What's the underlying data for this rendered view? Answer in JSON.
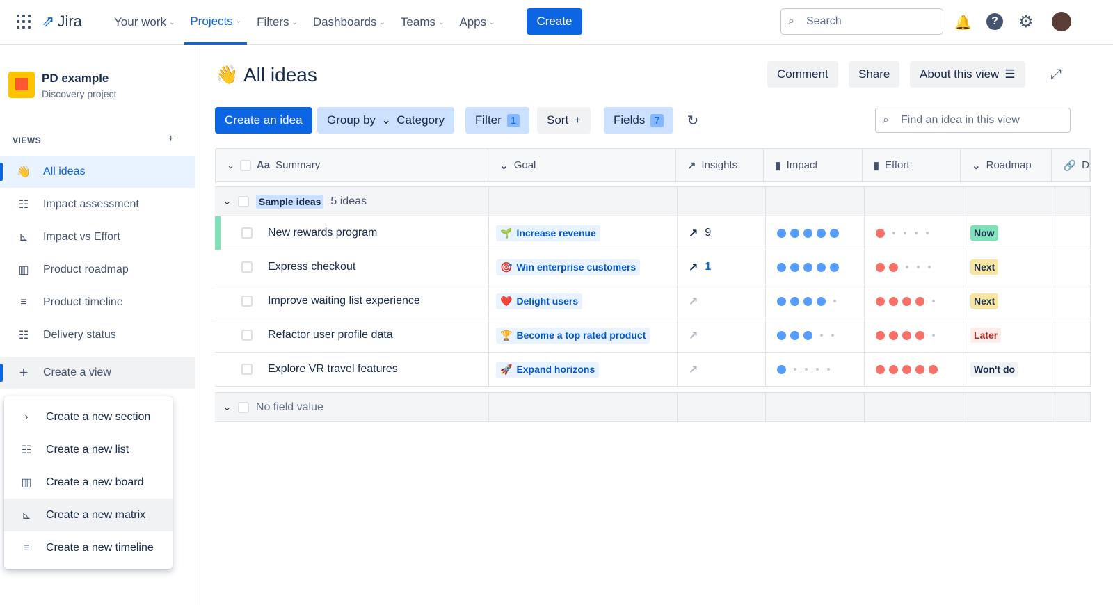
{
  "topnav": {
    "product": "Jira",
    "items": [
      "Your work",
      "Projects",
      "Filters",
      "Dashboards",
      "Teams",
      "Apps"
    ],
    "active": "Projects",
    "create": "Create",
    "search_placeholder": "Search"
  },
  "project": {
    "name": "PD example",
    "type": "Discovery project"
  },
  "sidebar": {
    "views_label": "VIEWS",
    "items": [
      {
        "label": "All ideas",
        "icon": "wave-emoji"
      },
      {
        "label": "Impact assessment",
        "icon": "list-icon"
      },
      {
        "label": "Impact vs Effort",
        "icon": "matrix-icon"
      },
      {
        "label": "Product roadmap",
        "icon": "board-icon"
      },
      {
        "label": "Product timeline",
        "icon": "timeline-icon"
      },
      {
        "label": "Delivery status",
        "icon": "list-icon"
      }
    ],
    "create_view": "Create a view"
  },
  "create_menu": {
    "items": [
      "Create a new section",
      "Create a new list",
      "Create a new board",
      "Create a new matrix",
      "Create a new timeline"
    ]
  },
  "header": {
    "title": "All ideas",
    "comment": "Comment",
    "share": "Share",
    "about": "About this view"
  },
  "toolbar": {
    "create_idea": "Create an idea",
    "group_by": "Group by",
    "group_value": "Category",
    "filter": "Filter",
    "filter_count": "1",
    "sort": "Sort",
    "fields": "Fields",
    "fields_count": "7",
    "find_placeholder": "Find an idea in this view"
  },
  "table": {
    "columns": [
      "Summary",
      "Goal",
      "Insights",
      "Impact",
      "Effort",
      "Roadmap",
      "D"
    ],
    "group": {
      "name": "Sample ideas",
      "count": "5 ideas"
    },
    "rows": [
      {
        "summary": "New rewards program",
        "goal": "Increase revenue",
        "goal_icon": "🌱",
        "insights": "9",
        "impact": 5,
        "effort": 1,
        "roadmap": "Now"
      },
      {
        "summary": "Express checkout",
        "goal": "Win enterprise customers",
        "goal_icon": "🎯",
        "insights": "1",
        "impact": 5,
        "effort": 2,
        "roadmap": "Next"
      },
      {
        "summary": "Improve waiting list experience",
        "goal": "Delight users",
        "goal_icon": "❤️",
        "insights": "",
        "impact": 4,
        "effort": 4,
        "roadmap": "Next"
      },
      {
        "summary": "Refactor user profile data",
        "goal": "Become a top rated product",
        "goal_icon": "🏆",
        "insights": "",
        "impact": 3,
        "effort": 4,
        "roadmap": "Later"
      },
      {
        "summary": "Explore VR travel features",
        "goal": "Expand horizons",
        "goal_icon": "🚀",
        "insights": "",
        "impact": 1,
        "effort": 5,
        "roadmap": "Won't do"
      }
    ],
    "no_value_group": "No field value"
  },
  "colors": {
    "accent": "#0c66e4",
    "impact": "#579dff",
    "effort": "#f87168",
    "Now": "#7ee2b8",
    "Next": "#f8e6a0",
    "Later": "#ffeceb",
    "Won't do": "#f1f2f4"
  }
}
